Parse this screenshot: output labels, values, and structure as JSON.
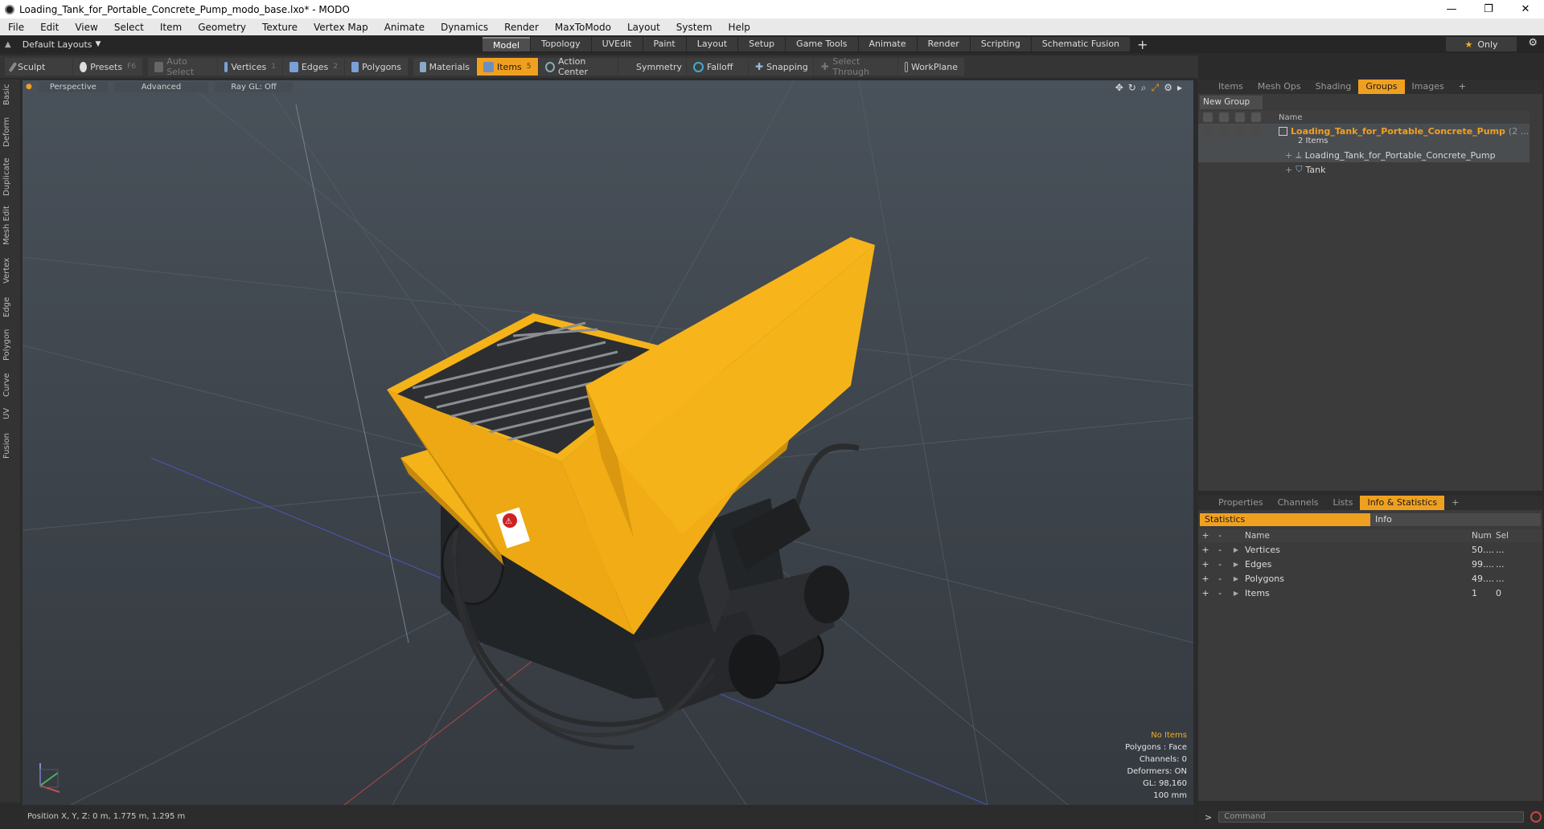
{
  "window": {
    "title": "Loading_Tank_for_Portable_Concrete_Pump_modo_base.lxo* - MODO",
    "controls": [
      "—",
      "❐",
      "✕"
    ]
  },
  "menu": [
    "File",
    "Edit",
    "View",
    "Select",
    "Item",
    "Geometry",
    "Texture",
    "Vertex Map",
    "Animate",
    "Dynamics",
    "Render",
    "MaxToModo",
    "Layout",
    "System",
    "Help"
  ],
  "layouts": {
    "selector": "Default Layouts",
    "tabs": [
      "Model",
      "Topology",
      "UVEdit",
      "Paint",
      "Layout",
      "Setup",
      "Game Tools",
      "Animate",
      "Render",
      "Scripting",
      "Schematic Fusion"
    ],
    "active": "Model",
    "only_label": "Only"
  },
  "toolbar": {
    "sculpt": "Sculpt",
    "presets": "Presets",
    "presets_key": "F6",
    "auto_select": "Auto Select",
    "vertices": "Vertices",
    "vertices_num": "1",
    "edges": "Edges",
    "edges_num": "2",
    "polygons": "Polygons",
    "materials": "Materials",
    "items": "Items",
    "items_num": "5",
    "action_center": "Action Center",
    "symmetry": "Symmetry",
    "falloff": "Falloff",
    "snapping": "Snapping",
    "select_through": "Select Through",
    "workplane": "WorkPlane"
  },
  "left_tabs": [
    "Basic",
    "Deform",
    "Duplicate",
    "Mesh Edit",
    "Vertex",
    "Edge",
    "Polygon",
    "Curve",
    "UV",
    "Fusion"
  ],
  "viewport": {
    "view": "Perspective",
    "shading": "Advanced",
    "raygl": "Ray GL: Off",
    "info": {
      "selection": "No Items",
      "polygons": "Polygons : Face",
      "channels": "Channels: 0",
      "deformers": "Deformers: ON",
      "gl": "GL: 98,160",
      "scale": "100 mm"
    },
    "label_sign": "⚠"
  },
  "status": {
    "position": "Position X, Y, Z:   0 m, 1.775 m, 1.295 m"
  },
  "groups_panel": {
    "tabs": [
      "Items",
      "Mesh Ops",
      "Shading",
      "Groups",
      "Images"
    ],
    "active": "Groups",
    "new_group": "New Group",
    "col_name": "Name",
    "group_name": "Loading_Tank_for_Portable_Concrete_Pump",
    "group_suffix": "(2 ...",
    "group_count": "2 Items",
    "children": [
      "Loading_Tank_for_Portable_Concrete_Pump",
      "Tank"
    ]
  },
  "stats_panel": {
    "tabs": [
      "Properties",
      "Channels",
      "Lists",
      "Info & Statistics"
    ],
    "active": "Info & Statistics",
    "subtabs": [
      "Statistics",
      "Info"
    ],
    "columns": {
      "name": "Name",
      "num": "Num",
      "sel": "Sel"
    },
    "rows": [
      {
        "name": "Vertices",
        "num": "50....",
        "sel": "..."
      },
      {
        "name": "Edges",
        "num": "99....",
        "sel": "..."
      },
      {
        "name": "Polygons",
        "num": "49....",
        "sel": "..."
      },
      {
        "name": "Items",
        "num": "1",
        "sel": "0"
      }
    ]
  },
  "command": {
    "placeholder": "Command"
  },
  "colors": {
    "accent": "#f0a020",
    "tank": "#f5b31a",
    "viewport": "#42484f"
  }
}
